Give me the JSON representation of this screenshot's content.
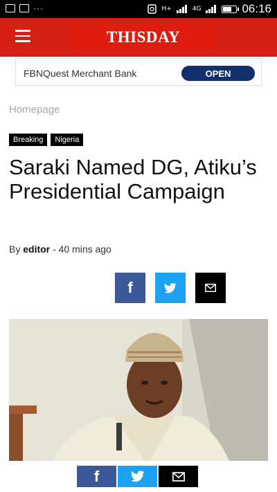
{
  "status_bar": {
    "time": "06:16",
    "signal_label_1": "H+",
    "signal_label_2": "4G"
  },
  "header": {
    "logo_text": "THISDAY"
  },
  "ad": {
    "text": "FBNQuest Merchant Bank",
    "button_label": "OPEN"
  },
  "breadcrumb": "Homepage",
  "tags": [
    "Breaking",
    "Nigeria"
  ],
  "article": {
    "title": "Saraki Named DG, Atiku’s Presidential Campaign",
    "by_label": "By",
    "author": "editor",
    "separator": " - ",
    "time_ago": "40 mins ago"
  },
  "share": {
    "facebook_glyph": "f"
  },
  "colors": {
    "brand_red": "#d51e14",
    "facebook": "#3b5998",
    "twitter": "#1da1f2",
    "ad_button": "#12306b"
  }
}
